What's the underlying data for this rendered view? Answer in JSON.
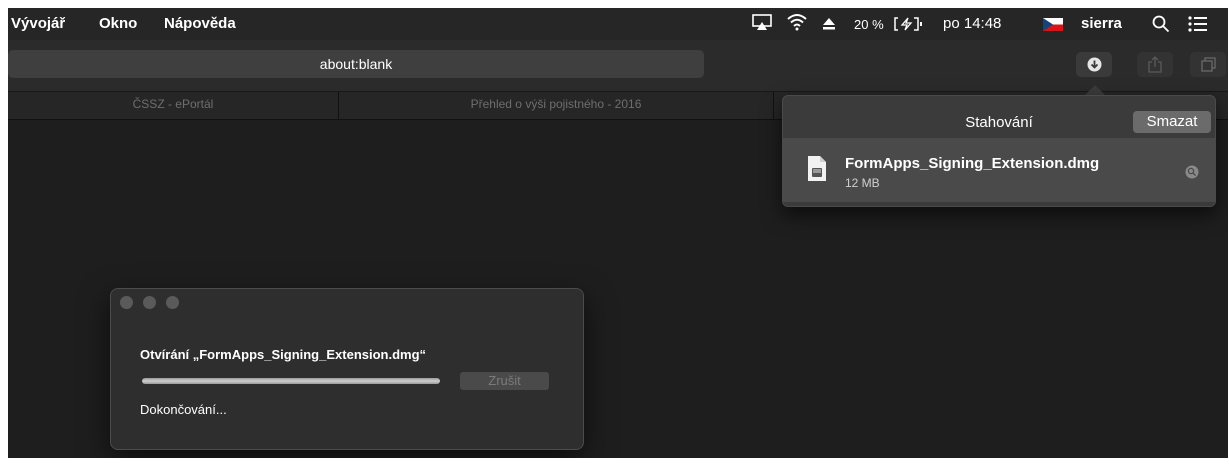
{
  "menubar": {
    "items": [
      {
        "label": "Vývojář"
      },
      {
        "label": "Okno"
      },
      {
        "label": "Nápověda"
      }
    ],
    "battery_text": "20 %",
    "clock": "po 14:48",
    "user": "sierra"
  },
  "toolbar": {
    "address": "about:blank"
  },
  "tabs": [
    {
      "label": "ČSSZ - ePortál"
    },
    {
      "label": "Přehled o výši pojistného - 2016"
    }
  ],
  "downloads": {
    "title": "Stahování",
    "clear_label": "Smazat",
    "items": [
      {
        "file": "FormApps_Signing_Extension.dmg",
        "size": "12 MB"
      }
    ]
  },
  "dialog": {
    "title": "Otvírání „FormApps_Signing_Extension.dmg“",
    "cancel_label": "Zrušit",
    "status": "Dokončování...",
    "progress": 1.0
  },
  "colors": {
    "background": "#1e1e1e",
    "menubar": "#262626",
    "popover": "#3b3b3b"
  }
}
